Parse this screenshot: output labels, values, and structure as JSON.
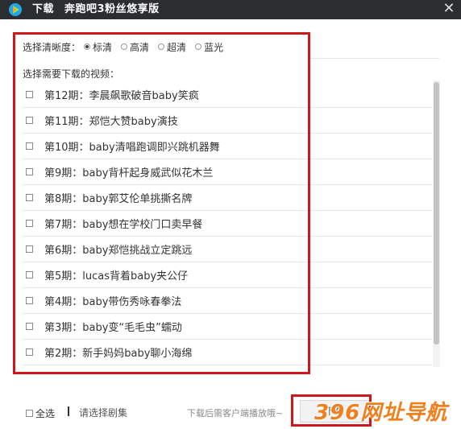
{
  "window": {
    "title_action": "下载",
    "title_name": "奔跑吧3粉丝悠享版",
    "close_symbol": "✕"
  },
  "quality": {
    "label": "选择清晰度：",
    "options": [
      {
        "label": "标清",
        "selected": true
      },
      {
        "label": "高清",
        "selected": false
      },
      {
        "label": "超清",
        "selected": false
      },
      {
        "label": "蓝光",
        "selected": false
      }
    ]
  },
  "videos": {
    "label": "选择需要下载的视频：",
    "items": [
      {
        "label": "第12期：李晨飙歌破音baby笑疯"
      },
      {
        "label": "第11期：郑恺大赞baby演技"
      },
      {
        "label": "第10期：baby清唱跑调即兴跳机器舞"
      },
      {
        "label": "第9期：baby背杆起身威武似花木兰"
      },
      {
        "label": "第8期：baby郭艾伦单挑撕名牌"
      },
      {
        "label": "第7期：baby想在学校门口卖早餐"
      },
      {
        "label": "第6期：baby郑恺挑战立定跳远"
      },
      {
        "label": "第5期：lucas背着baby夹公仔"
      },
      {
        "label": "第4期：baby带伤秀咏春拳法"
      },
      {
        "label": "第3期：baby变“毛毛虫”蠕动"
      },
      {
        "label": "第2期：新手妈妈baby聊小海绵"
      }
    ]
  },
  "footer": {
    "select_all": "全选",
    "select_hint": "请选择剧集",
    "play_hint": "下载后需客户端播放哦~",
    "download_button": "下载"
  },
  "watermark": {
    "text": "396网址导航"
  },
  "colors": {
    "titlebar": "#2b2d31",
    "highlight": "#d0171b",
    "watermark": "#f07f1e"
  }
}
